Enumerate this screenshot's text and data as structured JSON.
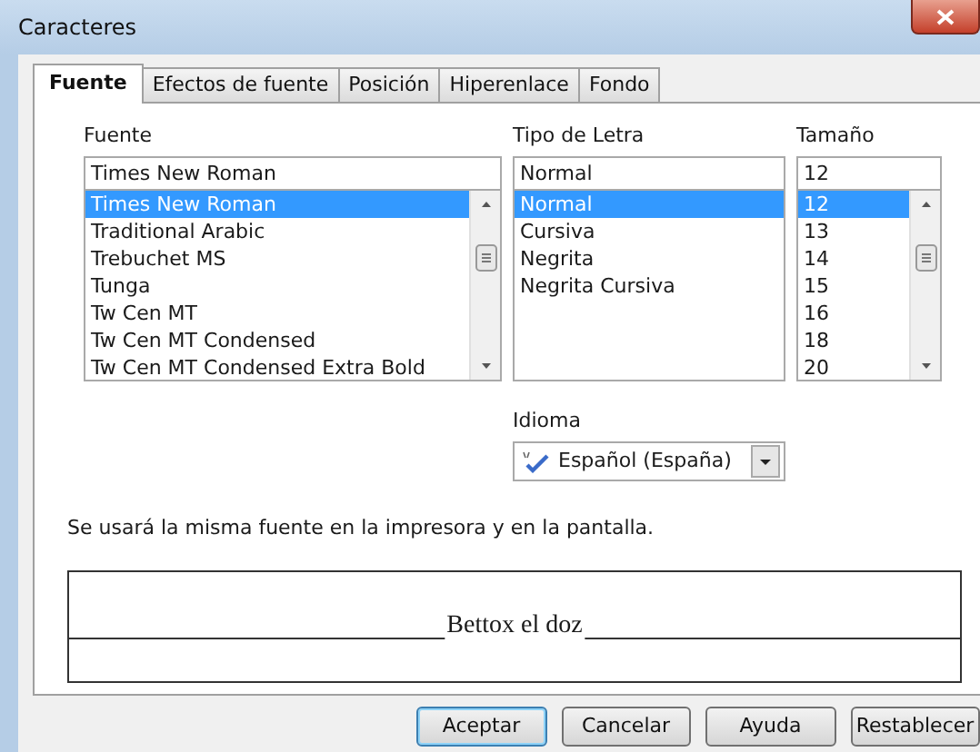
{
  "window": {
    "title": "Caracteres"
  },
  "tabs": [
    {
      "label": "Fuente",
      "selected": true
    },
    {
      "label": "Efectos de fuente",
      "selected": false
    },
    {
      "label": "Posición",
      "selected": false
    },
    {
      "label": "Hiperenlace",
      "selected": false
    },
    {
      "label": "Fondo",
      "selected": false
    }
  ],
  "font_columns": [
    {
      "label": "Fuente",
      "value": "Times New Roman",
      "scrollbar": true,
      "items": [
        {
          "label": "Times New Roman",
          "selected": true
        },
        {
          "label": "Traditional Arabic",
          "selected": false
        },
        {
          "label": "Trebuchet MS",
          "selected": false
        },
        {
          "label": "Tunga",
          "selected": false
        },
        {
          "label": "Tw Cen MT",
          "selected": false
        },
        {
          "label": "Tw Cen MT Condensed",
          "selected": false
        },
        {
          "label": "Tw Cen MT Condensed Extra Bold",
          "selected": false
        }
      ]
    },
    {
      "label": "Tipo de Letra",
      "value": "Normal",
      "scrollbar": false,
      "items": [
        {
          "label": "Normal",
          "selected": true
        },
        {
          "label": "Cursiva",
          "selected": false
        },
        {
          "label": "Negrita",
          "selected": false
        },
        {
          "label": "Negrita Cursiva",
          "selected": false
        }
      ]
    },
    {
      "label": "Tamaño",
      "value": "12",
      "scrollbar": true,
      "items": [
        {
          "label": "12",
          "selected": true
        },
        {
          "label": "13",
          "selected": false
        },
        {
          "label": "14",
          "selected": false
        },
        {
          "label": "15",
          "selected": false
        },
        {
          "label": "16",
          "selected": false
        },
        {
          "label": "18",
          "selected": false
        },
        {
          "label": "20",
          "selected": false
        }
      ]
    }
  ],
  "language": {
    "label": "Idioma",
    "value": "Español (España)"
  },
  "note": "Se usará la misma fuente en la impresora y en la pantalla.",
  "preview": {
    "text": "Bettox el doz"
  },
  "buttons": [
    {
      "label": "Aceptar",
      "default": true
    },
    {
      "label": "Cancelar",
      "default": false
    },
    {
      "label": "Ayuda",
      "default": false
    },
    {
      "label": "Restablecer",
      "default": false
    }
  ]
}
